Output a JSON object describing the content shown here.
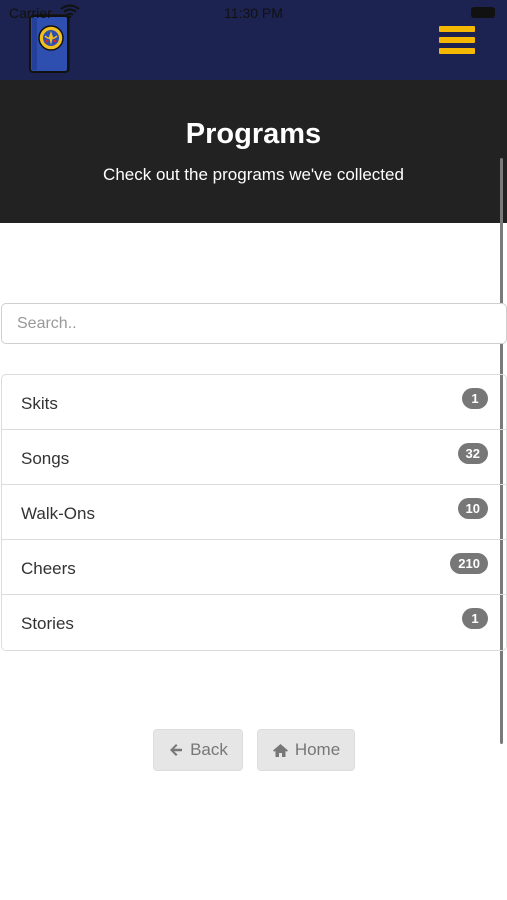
{
  "status_bar": {
    "carrier": "Carrier",
    "time": "11:30 PM"
  },
  "navbar": {
    "logo_icon": "scout-book-logo-icon",
    "menu_icon": "hamburger-menu-icon",
    "accent_color": "#f5b800",
    "background_color": "#1c2351"
  },
  "header": {
    "title": "Programs",
    "subtitle": "Check out the programs we've collected"
  },
  "search": {
    "placeholder": "Search..",
    "value": ""
  },
  "list": {
    "items": [
      {
        "label": "Skits",
        "count": "1"
      },
      {
        "label": "Songs",
        "count": "32"
      },
      {
        "label": "Walk-Ons",
        "count": "10"
      },
      {
        "label": "Cheers",
        "count": "210"
      },
      {
        "label": "Stories",
        "count": "1"
      }
    ]
  },
  "buttons": {
    "back": {
      "label": "Back",
      "icon": "arrow-left-icon"
    },
    "home": {
      "label": "Home",
      "icon": "home-icon"
    }
  }
}
